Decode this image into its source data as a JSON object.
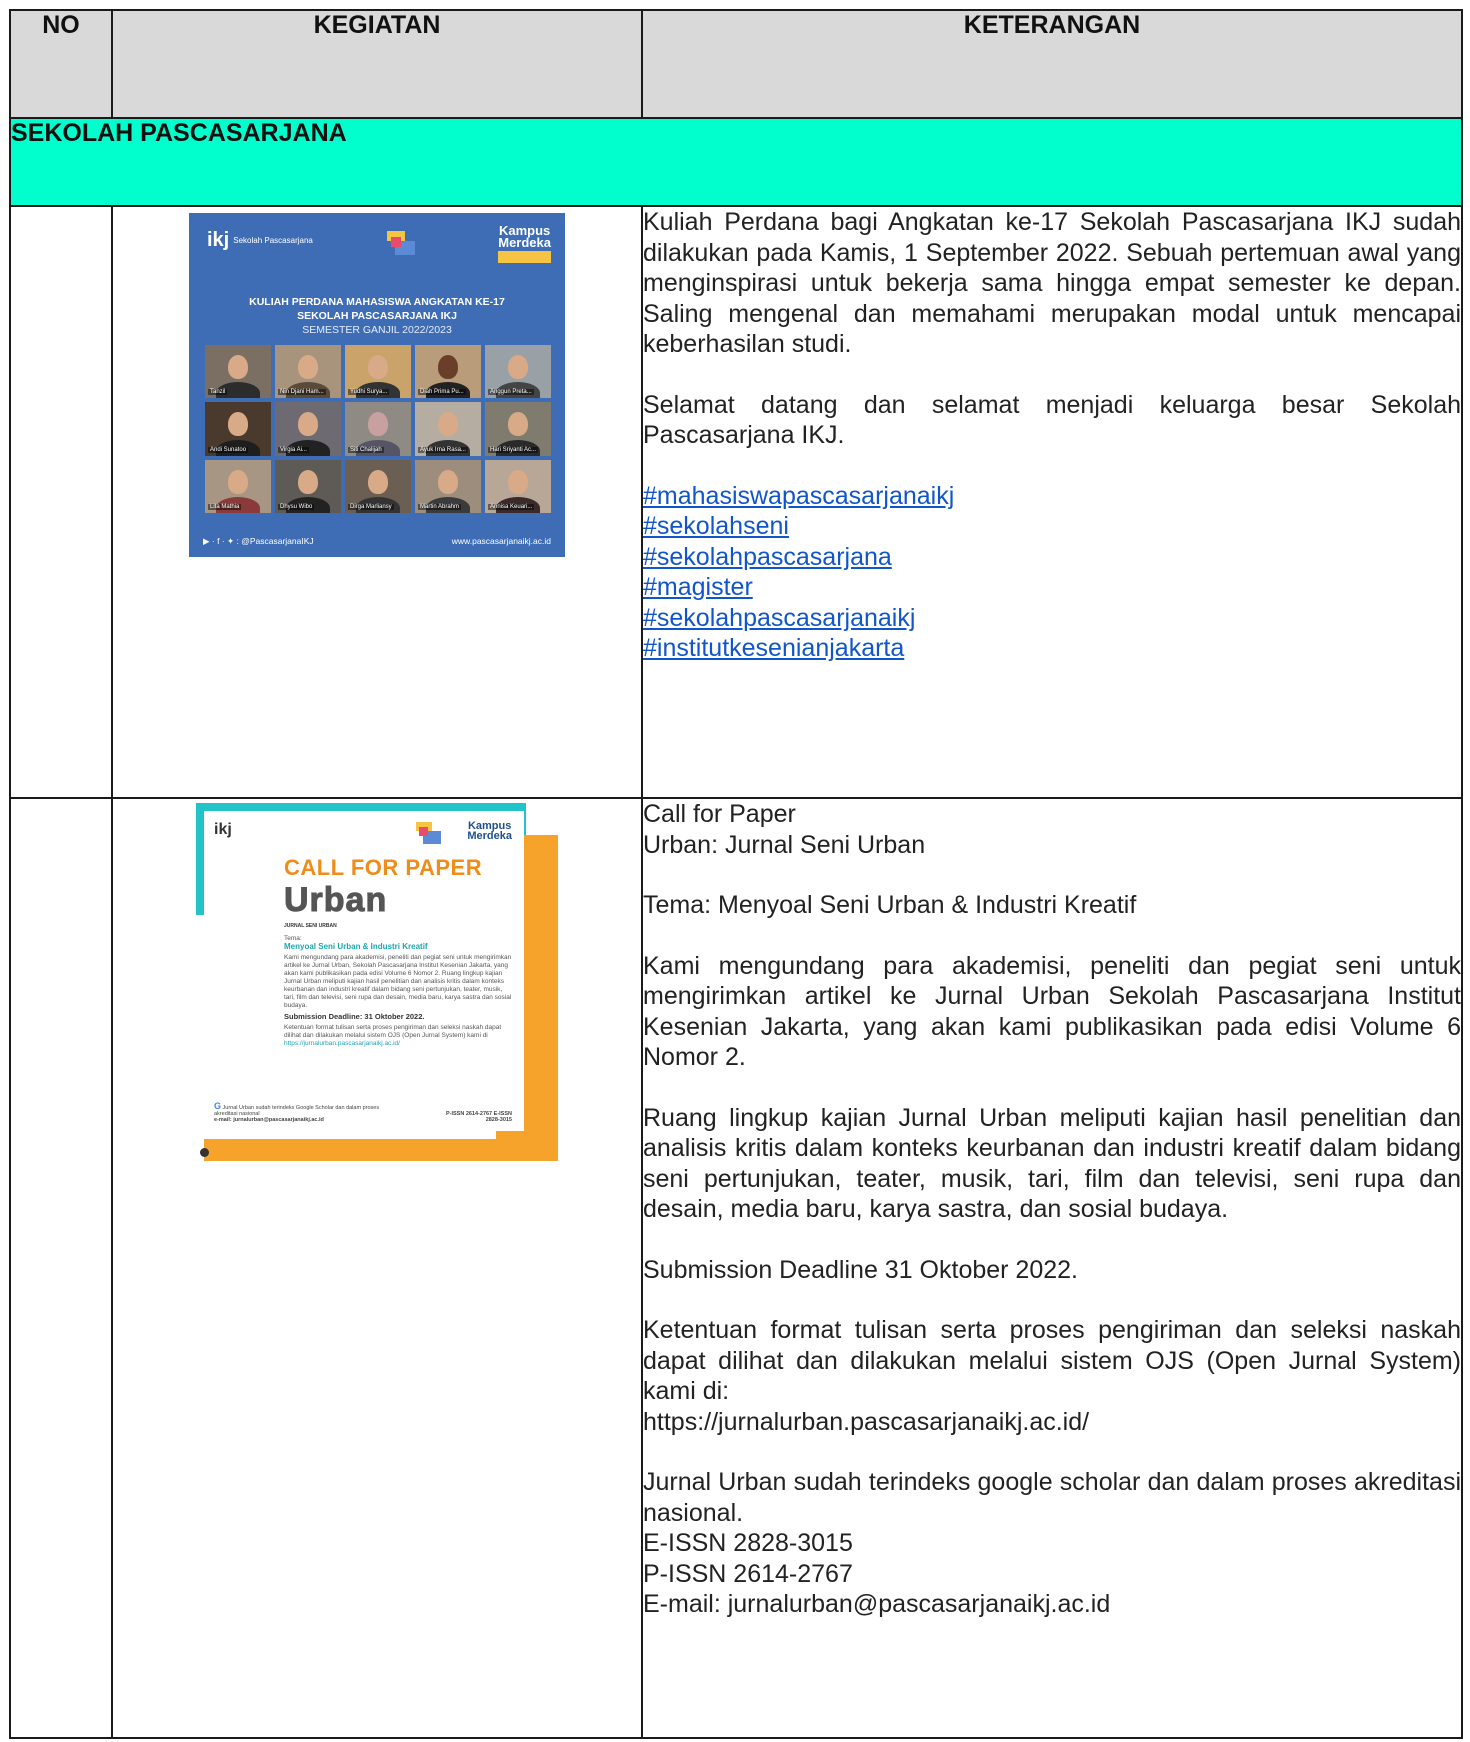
{
  "header": {
    "no": "NO",
    "kegiatan": "KEGIATAN",
    "keterangan": "KETERANGAN"
  },
  "section_title": "SEKOLAH PASCASARJANA",
  "rows": [
    {
      "poster": {
        "logo": "ikj",
        "logo_sub": "Sekolah Pascasarjana",
        "badge_top": "Kampus",
        "badge_bottom": "Merdeka",
        "title_line1": "KULIAH PERDANA MAHASISWA ANGKATAN KE-17",
        "title_line2": "SEKOLAH PASCASARJANA IKJ",
        "title_line3": "SEMESTER GANJIL 2022/2023",
        "participants": [
          "Tanzil",
          "Nin Djani Ham...",
          "Yudhi Surya...",
          "Diah Prima Pu...",
          "Anggun Preta...",
          "Andi Sunatoo",
          "Virgia Ai...",
          "Siti Chalijah",
          "Ayuk Irna Rasa...",
          "Hari Sriyanti Ac...",
          "Lita Mathia",
          "Dhysu Wibo",
          "Dirga Marliansy",
          "Martin Abrahm",
          "Annisa Keuari..."
        ],
        "social": "@PascasarjanaIKJ",
        "website": "www.pascasarjanaikj.ac.id"
      },
      "paragraph1": "Kuliah Perdana bagi Angkatan ke-17 Sekolah Pascasarjana IKJ sudah dilakukan pada Kamis, 1 September 2022. Sebuah pertemuan awal yang menginspirasi untuk bekerja sama hingga empat semester ke depan. Saling mengenal dan memahami merupakan modal untuk mencapai keberhasilan studi.",
      "paragraph2": "Selamat datang dan selamat menjadi keluarga besar Sekolah Pascasarjana IKJ.",
      "hashtags": [
        "#mahasiswapascasarjanaikj",
        "#sekolahseni",
        "#sekolahpascasarjana",
        "#magister",
        "#sekolahpascasarjanaikj",
        "#institutkesenianjakarta"
      ]
    },
    {
      "poster": {
        "logo": "ikj",
        "badge_top": "Kampus",
        "badge_bottom": "Merdeka",
        "cfp": "CALL FOR PAPER",
        "urban": "Urban",
        "jsu": "JURNAL SENI URBAN",
        "tema_label": "Tema:",
        "tema": "Menyoal Seni Urban & Industri Kreatif",
        "body": "Kami mengundang para akademisi, peneliti dan pegiat seni untuk mengirimkan artikel ke Jurnal Urban, Sekolah Pascasarjana Institut Kesenian Jakarta, yang akan kami publikasikan pada edisi Volume 6 Nomor 2. Ruang lingkup kajian Jurnal Urban meliputi kajian hasil penelitian dan analisis kritis dalam konteks keurbanan dan industri kreatif dalam bidang seni pertunjukan, teater, musik, tari, film dan televisi, seni rupa dan desain, media baru, karya sastra dan sosial budaya.",
        "deadline": "Submission Deadline: 31 Oktober 2022.",
        "ojs": "Ketentuan format tulisan serta proses pengiriman dan seleksi naskah dapat dilihat dan dilakukan melalui sistem OJS (Open Jurnal System) kami di",
        "link": "https://jurnalurban.pascasarjanaikj.ac.id/",
        "scholar": "Jurnal Urban sudah terindeks Google Scholar dan dalam proses akreditasi nasional",
        "email": "e-mail: jurnalurban@pascasarjanaikj.ac.id",
        "issn": "P-ISSN 2614-2767 E-ISSN 2828-3015"
      },
      "line1": "Call for Paper",
      "line2": "Urban: Jurnal Seni Urban",
      "tema": "Tema: Menyoal Seni Urban & Industri Kreatif",
      "p_invite": "Kami mengundang para akademisi, peneliti dan pegiat seni untuk mengirimkan artikel ke Jurnal Urban Sekolah Pascasarjana Institut Kesenian Jakarta, yang akan kami publikasikan pada edisi Volume 6 Nomor 2.",
      "p_scope": "Ruang lingkup kajian Jurnal Urban meliputi kajian hasil penelitian dan analisis kritis dalam konteks keurbanan dan industri kreatif dalam bidang seni pertunjukan, teater, musik, tari, film dan televisi, seni rupa dan desain, media baru, karya sastra, dan sosial budaya.",
      "deadline": "Submission Deadline 31 Oktober 2022.",
      "p_ojs": "Ketentuan format tulisan serta proses pengiriman dan seleksi naskah dapat dilihat dan dilakukan melalui sistem OJS (Open Jurnal System) kami di:",
      "url": "https://jurnalurban.pascasarjanaikj.ac.id/",
      "p_index": "Jurnal Urban sudah terindeks google scholar dan dalam proses akreditasi nasional.",
      "eissn": "E-ISSN 2828-3015",
      "pissn": "P-ISSN 2614-2767",
      "email": "E-mail: jurnalurban@pascasarjanaikj.ac.id"
    }
  ],
  "colors": {
    "section_bg": "#00ffcc",
    "header_bg": "#d9d9d9",
    "link": "#1155cc"
  }
}
